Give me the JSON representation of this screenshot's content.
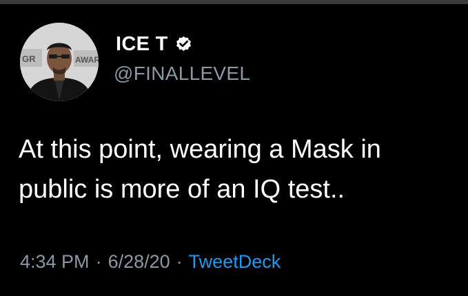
{
  "tweet": {
    "display_name": "ICE T",
    "handle": "@FINALLEVEL",
    "verified": true,
    "avatar_backdrop_text_left": "GR",
    "avatar_backdrop_text_right": "AWAR",
    "text": "At this point, wearing a Mask in\npublic is more of an IQ test..",
    "time": "4:34 PM",
    "separator": "·",
    "date": "6/28/20",
    "source": "TweetDeck"
  },
  "colors": {
    "background": "#000000",
    "primary_text": "#ffffff",
    "secondary_text": "#8b98a5",
    "link": "#1d9bf0"
  },
  "icons": {
    "verified": "verified-badge-icon"
  }
}
